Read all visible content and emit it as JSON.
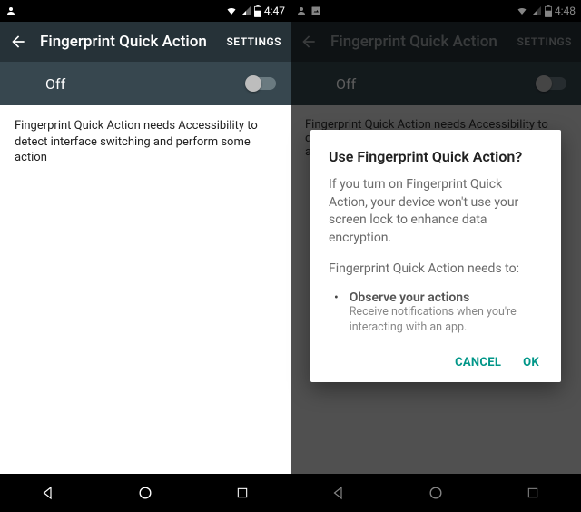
{
  "left": {
    "status": {
      "time": "4:47"
    },
    "appbar": {
      "title": "Fingerprint Quick Action",
      "settings": "SETTINGS"
    },
    "toggle": {
      "label": "Off"
    },
    "body": "Fingerprint Quick Action needs Accessibility to detect interface switching and perform some action"
  },
  "right": {
    "status": {
      "time": "4:48"
    },
    "appbar": {
      "title": "Fingerprint Quick Action",
      "settings": "SETTINGS"
    },
    "toggle": {
      "label": "Off"
    },
    "body": "Fingerprint Quick Action needs Accessibility to detect interface switching and perform some action",
    "dialog": {
      "title": "Use Fingerprint Quick Action?",
      "p1": "If you turn on Fingerprint Quick Action, your device won't use your screen lock to enhance data encryption.",
      "p2": "Fingerprint Quick Action needs to:",
      "bullet_title": "Observe your actions",
      "bullet_desc": "Receive notifications when you're interacting with an app.",
      "cancel": "CANCEL",
      "ok": "OK"
    }
  }
}
